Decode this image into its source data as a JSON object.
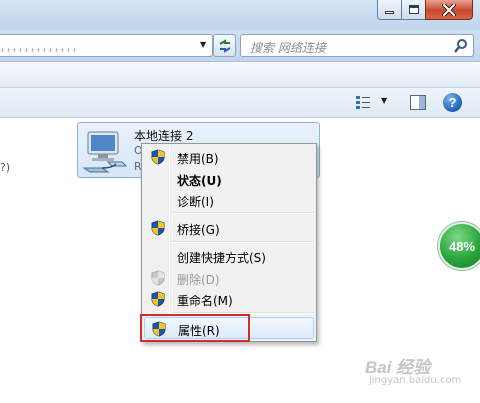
{
  "window": {
    "controls": {
      "minimize_icon": "minimize-icon",
      "maximize_icon": "maximize-icon",
      "close_icon": "close-icon"
    }
  },
  "address_bar": {
    "path_text": "，，，，，，，，，，，，，",
    "dropdown_icon": "chevron-down-icon",
    "refresh_icon": "refresh-icon"
  },
  "search": {
    "placeholder": "搜索 网络连接",
    "icon": "search-icon"
  },
  "toolbar": {
    "view_icon": "view-options-icon",
    "pane_icon": "preview-pane-icon",
    "help_label": "?"
  },
  "left_edge_text": "?)",
  "connection": {
    "name": "本地连接 2",
    "status_line": "O",
    "device_line": "Re",
    "icon": "network-adapter-icon"
  },
  "context_menu": {
    "items": [
      {
        "label": "禁用(B)",
        "shield": true,
        "style": "normal"
      },
      {
        "label": "状态(U)",
        "shield": false,
        "style": "bold"
      },
      {
        "label": "诊断(I)",
        "shield": false,
        "style": "normal"
      },
      {
        "label": "桥接(G)",
        "shield": true,
        "style": "normal"
      },
      {
        "label": "创建快捷方式(S)",
        "shield": false,
        "style": "normal"
      },
      {
        "label": "删除(D)",
        "shield": true,
        "style": "disabled"
      },
      {
        "label": "重命名(M)",
        "shield": true,
        "style": "normal"
      },
      {
        "label": "属性(R)",
        "shield": true,
        "style": "highlighted"
      }
    ]
  },
  "progress_badge": {
    "label": "48%",
    "value": 48,
    "color": "#2aa43d"
  },
  "watermark": {
    "brand": "Bai 经验",
    "url": "jingyan.baidu.com"
  },
  "colors": {
    "highlight_border": "#d42b2b",
    "menu_bg": "#f1f1f1",
    "tile_border": "#8db2dd"
  }
}
